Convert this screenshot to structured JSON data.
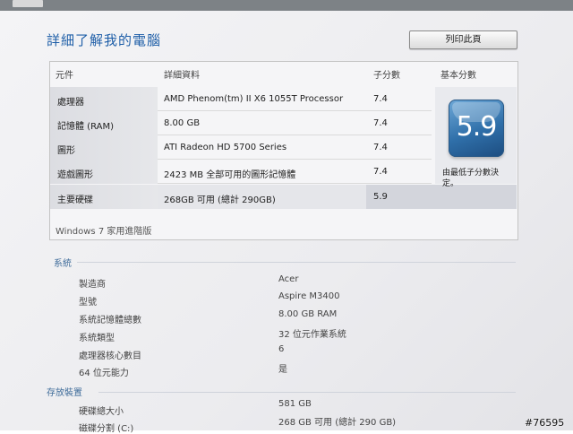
{
  "page": {
    "title": "詳細了解我的電腦",
    "print_button": "列印此頁"
  },
  "wei": {
    "headers": {
      "component": "元件",
      "details": "詳細資料",
      "subscore": "子分數",
      "base_score": "基本分數"
    },
    "rows": [
      {
        "label": "處理器",
        "details": "AMD Phenom(tm) II X6 1055T Processor",
        "score": "7.4"
      },
      {
        "label": "記憶體 (RAM)",
        "details": "8.00 GB",
        "score": "7.4"
      },
      {
        "label": "圖形",
        "details": "ATI Radeon HD 5700 Series",
        "score": "7.4"
      },
      {
        "label": "遊戲圖形",
        "details": "2423 MB 全部可用的圖形記憶體",
        "score": "7.4"
      },
      {
        "label": "主要硬碟",
        "details": "268GB 可用 (總計 290GB)",
        "score": "5.9"
      }
    ],
    "base_score": "5.9",
    "base_note": "由最低子分數決定。",
    "edition": "Windows 7 家用進階版"
  },
  "system": {
    "title": "系統",
    "items": [
      {
        "label": "製造商",
        "value": "Acer"
      },
      {
        "label": "型號",
        "value": "Aspire M3400"
      },
      {
        "label": "系統記憶體總數",
        "value": "8.00 GB RAM"
      },
      {
        "label": "系統類型",
        "value": "32 位元作業系統"
      },
      {
        "label": "處理器核心數目",
        "value": "6"
      },
      {
        "label": "64 位元能力",
        "value": "是"
      }
    ]
  },
  "storage": {
    "title": "存放裝置",
    "items": [
      {
        "label": "硬碟總大小",
        "value": "581 GB"
      },
      {
        "label": "磁碟分割 (C:)",
        "value": "268 GB 可用 (總計 290 GB)"
      }
    ]
  },
  "watermark": "#76595",
  "colors": {
    "title_blue": "#1f5fa8",
    "section_blue": "#3f6c9a",
    "badge_blue": "#2f6fa9"
  }
}
